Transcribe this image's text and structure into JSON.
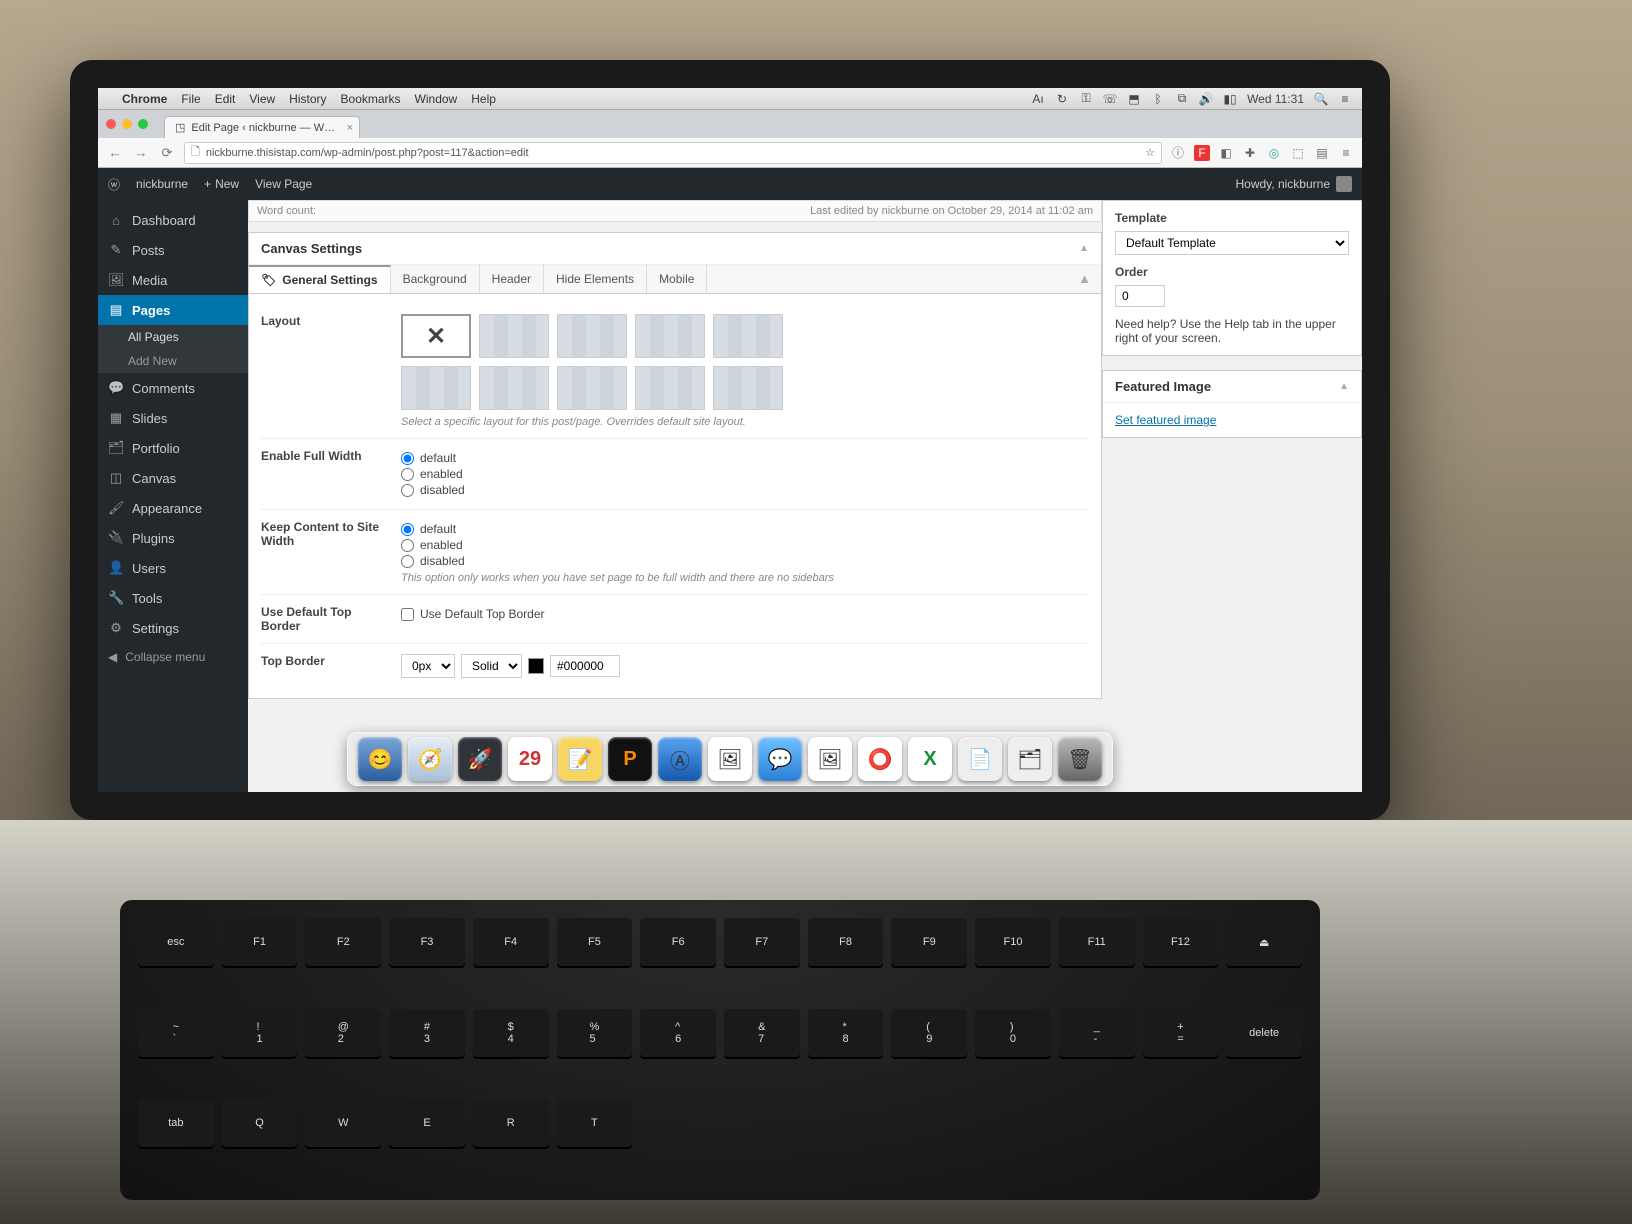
{
  "mac_menu": {
    "app": "Chrome",
    "items": [
      "File",
      "Edit",
      "View",
      "History",
      "Bookmarks",
      "Window",
      "Help"
    ],
    "status_time": "Wed 11:31"
  },
  "chrome": {
    "tab_title": "Edit Page ‹ nickburne — W…",
    "url": "nickburne.thisistap.com/wp-admin/post.php?post=117&action=edit"
  },
  "adminbar": {
    "site": "nickburne",
    "new": "New",
    "view": "View Page",
    "howdy": "Howdy, nickburne"
  },
  "sidebar": {
    "items": [
      {
        "label": "Dashboard",
        "icon": "dashboard-icon"
      },
      {
        "label": "Posts",
        "icon": "pin-icon"
      },
      {
        "label": "Media",
        "icon": "media-icon"
      },
      {
        "label": "Pages",
        "icon": "page-icon",
        "active": true
      },
      {
        "label": "Comments",
        "icon": "comment-icon"
      },
      {
        "label": "Slides",
        "icon": "slides-icon"
      },
      {
        "label": "Portfolio",
        "icon": "portfolio-icon"
      },
      {
        "label": "Canvas",
        "icon": "canvas-icon"
      },
      {
        "label": "Appearance",
        "icon": "brush-icon"
      },
      {
        "label": "Plugins",
        "icon": "plug-icon"
      },
      {
        "label": "Users",
        "icon": "user-icon"
      },
      {
        "label": "Tools",
        "icon": "wrench-icon"
      },
      {
        "label": "Settings",
        "icon": "gear-icon"
      }
    ],
    "sub_pages": {
      "all": "All Pages",
      "add": "Add New"
    },
    "collapse": "Collapse menu"
  },
  "last_edited": "Last edited by nickburne on October 29, 2014 at 11:02 am",
  "word_count_label": "Word count:",
  "canvas": {
    "box_title": "Canvas Settings",
    "tabs": [
      "General Settings",
      "Background",
      "Header",
      "Hide Elements",
      "Mobile"
    ],
    "layout_label": "Layout",
    "layout_help": "Select a specific layout for this post/page. Overrides default site layout.",
    "full_width": {
      "label": "Enable Full Width",
      "options": [
        "default",
        "enabled",
        "disabled"
      ]
    },
    "keep_width": {
      "label": "Keep Content to Site Width",
      "options": [
        "default",
        "enabled",
        "disabled"
      ],
      "help": "This option only works when you have set page to be full width and there are no sidebars"
    },
    "use_default_border": {
      "label": "Use Default Top Border",
      "checkbox": "Use Default Top Border"
    },
    "top_border": {
      "label": "Top Border",
      "size": "0px",
      "style": "Solid",
      "color": "#000000"
    }
  },
  "right": {
    "template_label": "Template",
    "template_value": "Default Template",
    "order_label": "Order",
    "order_value": "0",
    "help_text": "Need help? Use the Help tab in the upper right of your screen.",
    "featured_title": "Featured Image",
    "featured_link": "Set featured image"
  },
  "dock_apps": [
    "finder",
    "safari",
    "launchpad",
    "calendar",
    "notes",
    "reminders",
    "appstore",
    "maps",
    "messages",
    "photos",
    "chrome",
    "excel",
    "pages",
    "preview",
    "trash"
  ]
}
